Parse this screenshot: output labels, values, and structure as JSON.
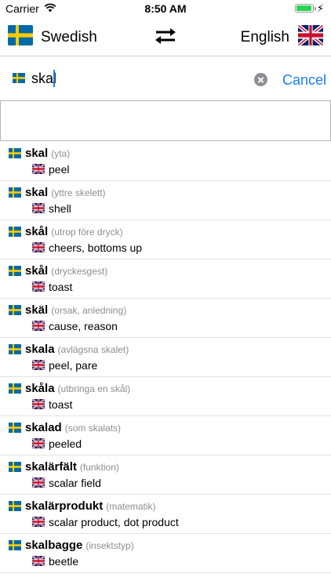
{
  "status": {
    "carrier": "Carrier",
    "time": "8:50 AM"
  },
  "header": {
    "source_language": "Swedish",
    "target_language": "English"
  },
  "search": {
    "value": "skal",
    "cancel_label": "Cancel"
  },
  "colors": {
    "accent": "#1a7cf5",
    "battery": "#2bd44f"
  },
  "icons": [
    "wifi-icon",
    "battery-icon",
    "charging-bolt-icon",
    "swedish-flag-icon",
    "uk-flag-icon",
    "swap-arrows-icon",
    "clear-icon"
  ],
  "results": [
    {
      "word": "skal",
      "note": "(yta)",
      "translation": "peel"
    },
    {
      "word": "skal",
      "note": "(yttre skelett)",
      "translation": "shell"
    },
    {
      "word": "skål",
      "note": "(utrop före dryck)",
      "translation": "cheers, bottoms up"
    },
    {
      "word": "skål",
      "note": "(dryckesgest)",
      "translation": "toast"
    },
    {
      "word": "skäl",
      "note": "(orsak, anledning)",
      "translation": "cause, reason"
    },
    {
      "word": "skala",
      "note": "(avlägsna skalet)",
      "translation": "peel, pare"
    },
    {
      "word": "skåla",
      "note": "(utbringa en skål)",
      "translation": "toast"
    },
    {
      "word": "skalad",
      "note": "(som skalats)",
      "translation": "peeled"
    },
    {
      "word": "skalärfält",
      "note": "(funktion)",
      "translation": "scalar field"
    },
    {
      "word": "skalärprodukt",
      "note": "(matematik)",
      "translation": "scalar product, dot product"
    },
    {
      "word": "skalbagge",
      "note": "(insektstyp)",
      "translation": "beetle"
    }
  ]
}
